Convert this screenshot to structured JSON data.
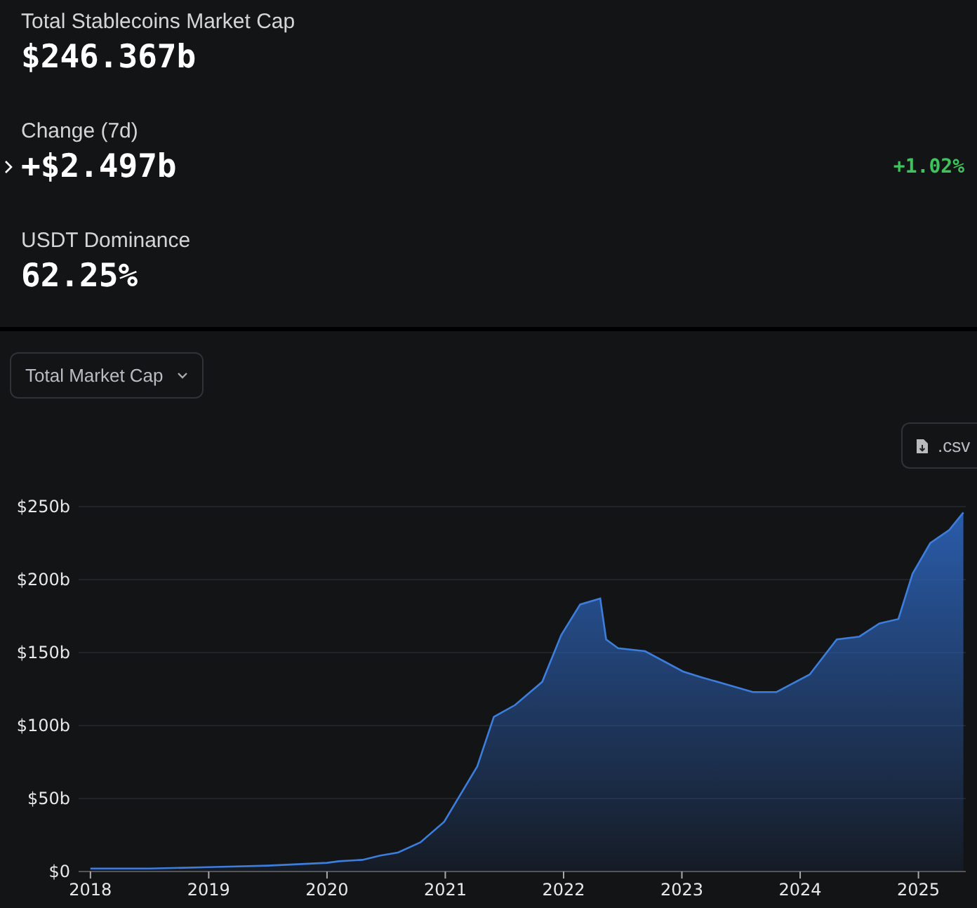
{
  "stats": [
    {
      "label": "Total Stablecoins Market Cap",
      "value": "$246.367b"
    },
    {
      "label": "Change (7d)",
      "value": "+$2.497b",
      "expandable": true,
      "change": "+1.02%"
    },
    {
      "label": "USDT Dominance",
      "value": "62.25%"
    }
  ],
  "metric_dropdown": {
    "value": "Total Market Cap"
  },
  "csv_button": {
    "label": ".csv"
  },
  "chart_data": {
    "type": "area",
    "x": [
      2018.0,
      2018.5,
      2019.0,
      2019.5,
      2019.75,
      2020.0,
      2020.1,
      2020.3,
      2020.45,
      2020.6,
      2020.79,
      2020.99,
      2021.27,
      2021.41,
      2021.59,
      2021.82,
      2021.98,
      2022.14,
      2022.31,
      2022.36,
      2022.46,
      2022.69,
      2023.01,
      2023.17,
      2023.6,
      2023.8,
      2024.08,
      2024.31,
      2024.5,
      2024.67,
      2024.83,
      2024.95,
      2025.1,
      2025.26,
      2025.38
    ],
    "values": [
      2,
      2,
      3,
      4,
      5,
      6,
      7,
      8,
      11,
      13,
      20,
      34,
      72,
      106,
      114,
      130,
      162,
      183,
      187,
      159,
      153,
      151,
      137,
      133,
      123,
      123,
      135,
      159,
      161,
      170,
      173,
      204,
      225,
      234,
      246
    ],
    "grid": true,
    "xlim": [
      2017.9,
      2025.4
    ],
    "ylim": [
      0,
      250
    ],
    "xticks": [
      2018,
      2019,
      2020,
      2021,
      2022,
      2023,
      2024,
      2025
    ],
    "yticks": [
      {
        "value": 0,
        "label": "$0"
      },
      {
        "value": 50,
        "label": "$50b"
      },
      {
        "value": 100,
        "label": "$100b"
      },
      {
        "value": 150,
        "label": "$150b"
      },
      {
        "value": 200,
        "label": "$200b"
      },
      {
        "value": 250,
        "label": "$250b"
      }
    ]
  }
}
